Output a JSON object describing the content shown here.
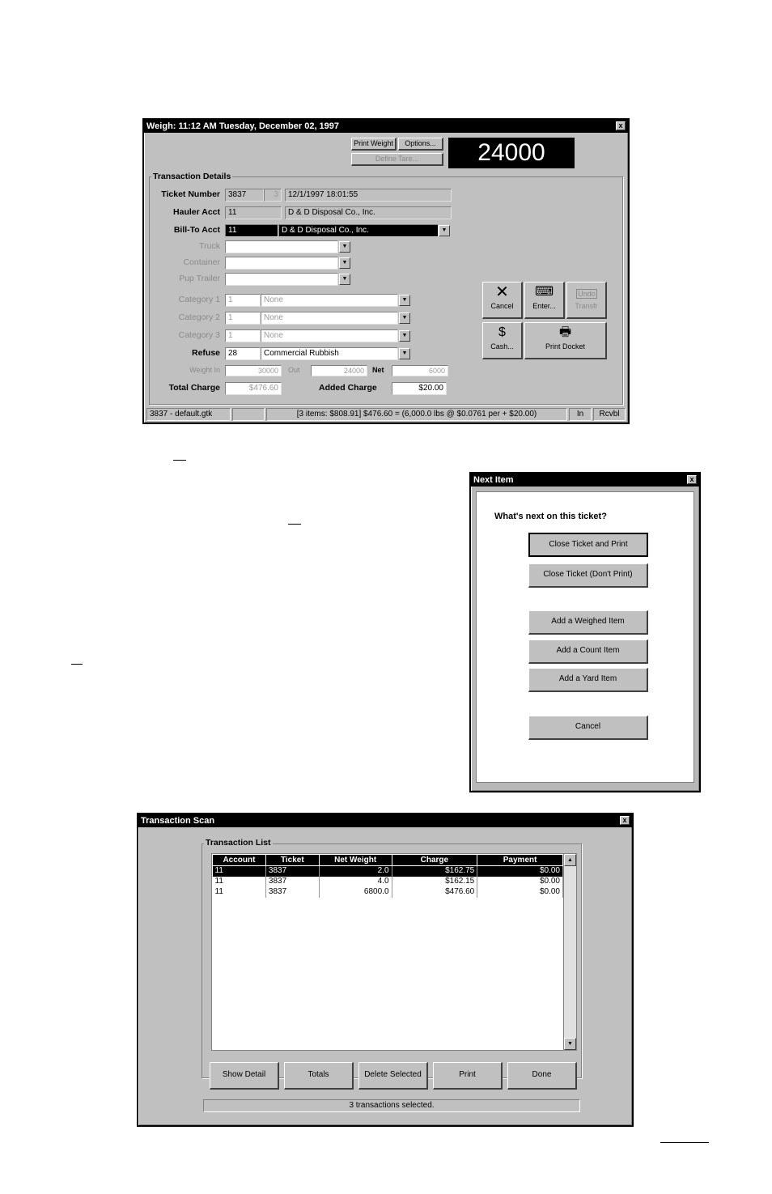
{
  "weigh": {
    "title": "Weigh:   11:12 AM    Tuesday, December 02, 1997",
    "close": "x",
    "btn_print_weight": "Print Weight",
    "btn_options": "Options...",
    "btn_define_tare": "Define Tare...",
    "scale_reading": "24000",
    "group_label": "Transaction Details",
    "labels": {
      "ticket": "Ticket Number",
      "hauler": "Hauler Acct",
      "billto": "Bill-To Acct",
      "truck": "Truck",
      "container": "Container",
      "pup": "Pup Trailer",
      "cat1": "Category 1",
      "cat2": "Category 2",
      "cat3": "Category 3",
      "refuse": "Refuse",
      "weight_in": "Weight In",
      "out": "Out",
      "net": "Net",
      "total_charge": "Total Charge",
      "added_charge": "Added Charge"
    },
    "values": {
      "ticket_no": "3837",
      "ticket_sub": "3",
      "ticket_date": "12/1/1997 18:01:55",
      "hauler_acct": "11",
      "hauler_name": "D & D Disposal Co., Inc.",
      "billto_acct": "11",
      "billto_name": "D & D Disposal Co., Inc.",
      "cat1_code": "1",
      "cat1_name": "None",
      "cat2_code": "1",
      "cat2_name": "None",
      "cat3_code": "1",
      "cat3_name": "None",
      "refuse_code": "28",
      "refuse_name": "Commercial Rubbish",
      "weight_in": "30000",
      "weight_out": "24000",
      "weight_net": "6000",
      "total_charge": "$476.60",
      "added_charge": "$20.00"
    },
    "actions": {
      "cancel": "Cancel",
      "enter": "Enter...",
      "undo": "Undo",
      "transfer": "Transfr",
      "cash": "Cash...",
      "print_docket": "Print Docket"
    },
    "status": {
      "file": "3837 - default.gtk",
      "summary": "[3 items: $808.91]   $476.60 = (6,000.0 lbs @ $0.0761 per + $20.00)",
      "mode1": "In",
      "mode2": "Rcvbl"
    }
  },
  "next_item": {
    "title": "Next Item",
    "close": "x",
    "prompt": "What's next on this ticket?",
    "buttons": [
      "Close Ticket and Print",
      "Close Ticket (Don't Print)",
      "Add a Weighed Item",
      "Add a Count Item",
      "Add a Yard Item",
      "Cancel"
    ]
  },
  "scan": {
    "title": "Transaction Scan",
    "close": "x",
    "group_label": "Transaction List",
    "columns": [
      "Account",
      "Ticket",
      "Net Weight",
      "Charge",
      "Payment"
    ],
    "rows": [
      [
        "11",
        "3837",
        "2.0",
        "$162.75",
        "$0.00"
      ],
      [
        "11",
        "3837",
        "4.0",
        "$162.15",
        "$0.00"
      ],
      [
        "11",
        "3837",
        "6800.0",
        "$476.60",
        "$0.00"
      ]
    ],
    "buttons": [
      "Show Detail",
      "Totals",
      "Delete Selected",
      "Print",
      "Done"
    ],
    "status": "3 transactions selected."
  }
}
